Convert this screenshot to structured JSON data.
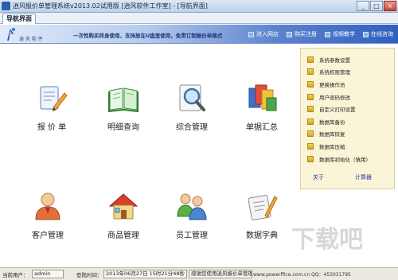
{
  "window": {
    "title": "逍风报价单管理系统v2013.02试用版 [逍风软件工作室] - [导航界面]",
    "controls": [
      "_",
      "□",
      "×"
    ]
  },
  "tabs": [
    {
      "label": "导航界面",
      "active": true
    }
  ],
  "banner": {
    "logo_text": "逍 风 软 件",
    "slogan": "一次性购买终身使用，支持放在U盘里使用，免责订制报价单格式",
    "links": [
      {
        "label": "进入网店",
        "icon": "shop-icon"
      },
      {
        "label": "购买注册",
        "icon": "register-icon"
      },
      {
        "label": "视频教学",
        "icon": "video-icon"
      },
      {
        "label": "在线咨询",
        "icon": "chat-icon"
      }
    ]
  },
  "modules": [
    {
      "label": "报 价 单",
      "icon": "quote-doc-icon"
    },
    {
      "label": "明细查询",
      "icon": "open-book-icon"
    },
    {
      "label": "综合管理",
      "icon": "magnifier-icon"
    },
    {
      "label": "单据汇总",
      "icon": "files-icon"
    },
    {
      "label": "客户管理",
      "icon": "customer-icon"
    },
    {
      "label": "商品管理",
      "icon": "house-icon"
    },
    {
      "label": "员工管理",
      "icon": "employees-icon"
    },
    {
      "label": "数据字典",
      "icon": "dictionary-icon"
    }
  ],
  "right_panel": {
    "items": [
      "系统参数设置",
      "系统权限管理",
      "更换操作员",
      "用户密码修改",
      "自定义打印设置",
      "数据库备份",
      "数据库恢复",
      "数据库压缩",
      "数据库初始化（慎用）"
    ],
    "links": [
      "关于",
      "计算器"
    ]
  },
  "status": {
    "user_label": "当前用户：",
    "user_value": "admin",
    "login_label": "登陆时间：",
    "login_value": "2013年06月27日 15时21分48秒",
    "message": "感谢您使用逍风报价单管理系统",
    "url_text": "www.powerffice.com.cn  QQ：453031795",
    "watermark": "下载吧"
  },
  "colors": {
    "banner_start": "#dfe9f8",
    "banner_end": "#2f5fbd",
    "panel_bg": "#fbf5d7",
    "link": "#1f3f9c"
  }
}
